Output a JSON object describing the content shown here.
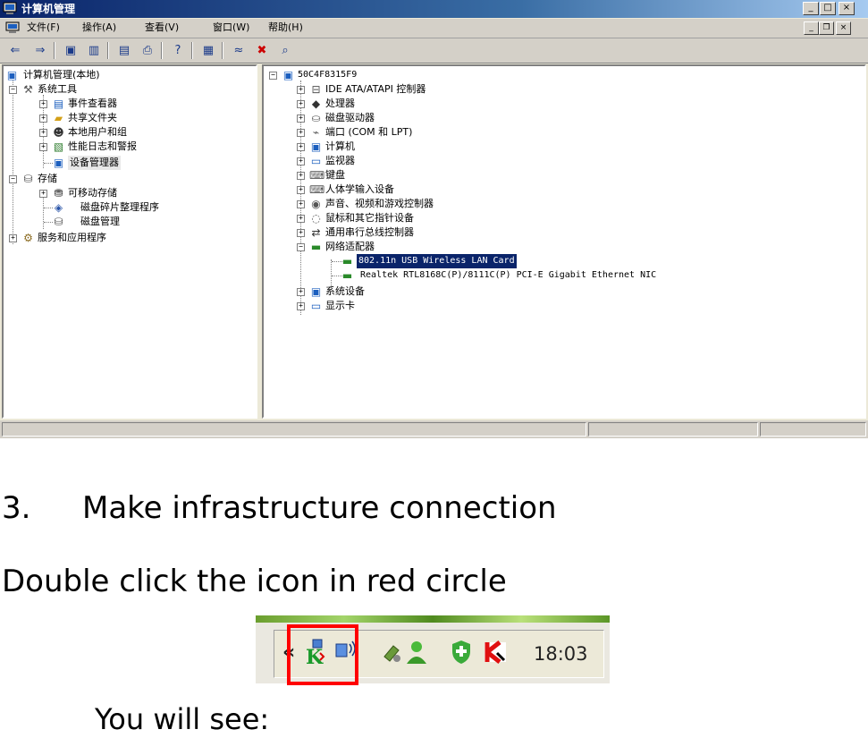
{
  "window": {
    "title": "计算机管理",
    "caption_min": "_",
    "caption_max": "□",
    "caption_close": "×",
    "menus": [
      "文件(F)",
      "操作(A)",
      "查看(V)",
      "窗口(W)",
      "帮助(H)"
    ],
    "mdi_min": "_",
    "mdi_restore": "❐",
    "mdi_close": "×"
  },
  "toolbar": {
    "icons": [
      "back-icon",
      "forward-icon",
      "up-folder-icon",
      "show-hide-tree-icon",
      "properties-icon",
      "print-icon",
      "help-icon",
      "console-icon",
      "disable-device-icon",
      "uninstall-device-icon",
      "scan-hardware-icon"
    ]
  },
  "left_tree": {
    "root": "计算机管理(本地)",
    "system_tools": "系统工具",
    "event_viewer": "事件查看器",
    "shared_folders": "共享文件夹",
    "local_users": "本地用户和组",
    "perf_logs": "性能日志和警报",
    "device_manager": "设备管理器",
    "storage": "存储",
    "removable_storage": "可移动存储",
    "defrag": "磁盘碎片整理程序",
    "disk_management": "磁盘管理",
    "services_apps": "服务和应用程序"
  },
  "right_tree": {
    "computer_name": "50C4F8315F9",
    "categories": [
      "IDE ATA/ATAPI 控制器",
      "处理器",
      "磁盘驱动器",
      "端口 (COM 和 LPT)",
      "计算机",
      "监视器",
      "键盘",
      "人体学输入设备",
      "声音、视频和游戏控制器",
      "鼠标和其它指针设备",
      "通用串行总线控制器"
    ],
    "network_adapters": "网络适配器",
    "adapter_1": "802.11n USB Wireless LAN Card",
    "adapter_2": "Realtek RTL8168C(P)/8111C(P) PCI-E Gigabit Ethernet NIC",
    "system_devices": "系统设备",
    "display_adapters": "显示卡"
  },
  "doc": {
    "step_number": "3.",
    "step_title": "Make infrastructure connection",
    "instruction": "Double click the icon in red circle",
    "you_will_see": "You will see:"
  },
  "tray": {
    "chevron": "«",
    "clock": "18:03",
    "icons": [
      "wireless-utility-icon",
      "network-connection-icon",
      "usb-device-icon",
      "messenger-user-icon",
      "security-shield-icon",
      "kaspersky-icon"
    ],
    "highlight_color": "#ff0000"
  }
}
